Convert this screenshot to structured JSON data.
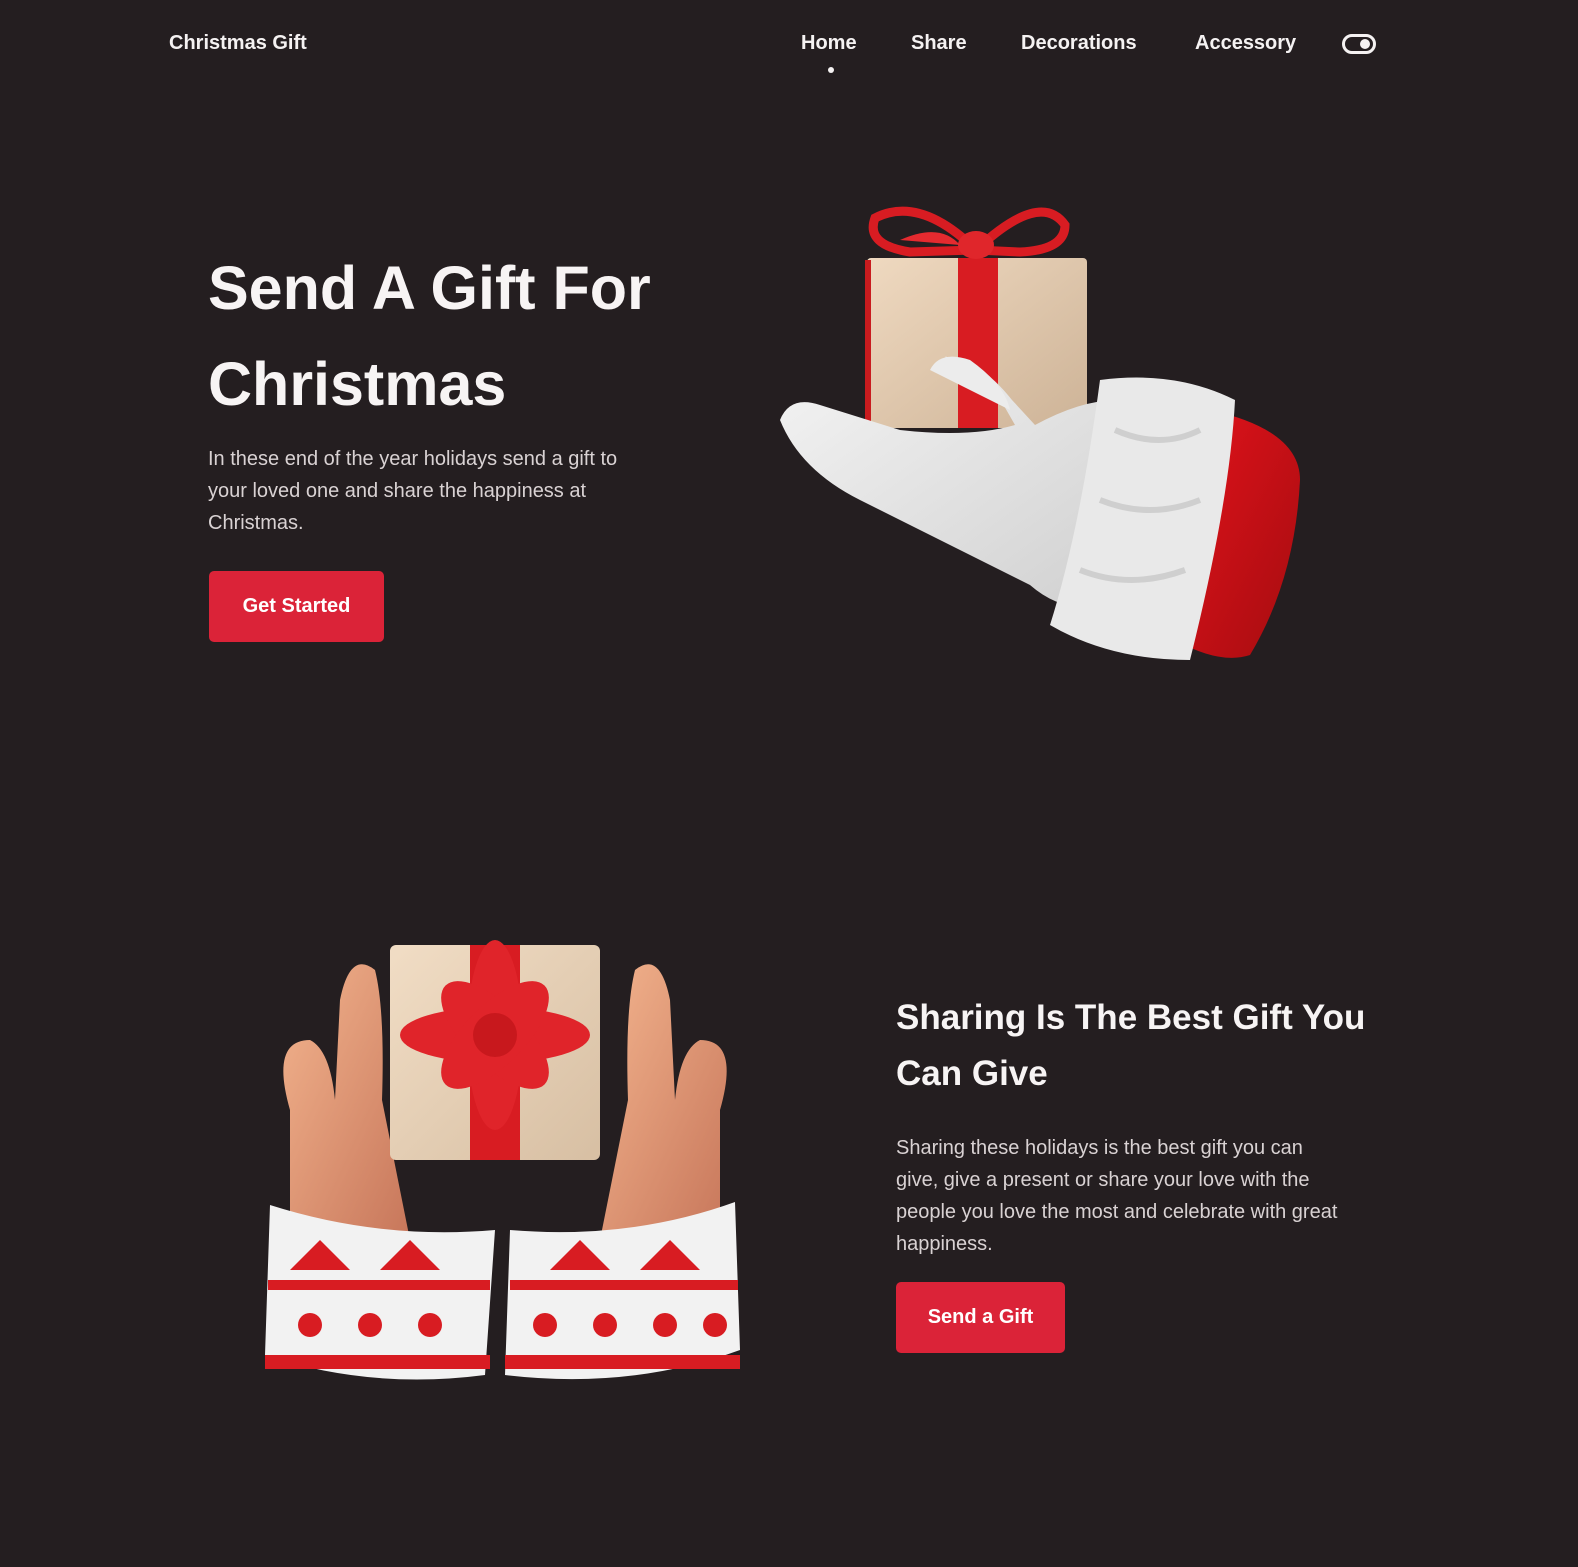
{
  "header": {
    "logo": "Christmas Gift",
    "nav": [
      "Home",
      "Share",
      "Decorations",
      "Accessory"
    ],
    "active_nav": "Home",
    "theme_toggle_icon": "toggle-icon"
  },
  "hero": {
    "title": "Send A Gift For Christmas",
    "text": "In these end of the year holidays send a gift to your loved one and share the happiness at Christmas.",
    "button": "Get Started",
    "image_icon": "santa-hand-gift-illustration"
  },
  "share": {
    "title": "Sharing Is The Best Gift You Can Give",
    "text": "Sharing these holidays is the best gift you can give, give a present or share your love with the people you love the most and celebrate with great happiness.",
    "button": "Send a Gift",
    "image_icon": "hands-gift-illustration"
  },
  "colors": {
    "background": "#241e20",
    "accent": "#db2338",
    "text": "#f5f2f2",
    "muted": "#d9d2d3"
  }
}
